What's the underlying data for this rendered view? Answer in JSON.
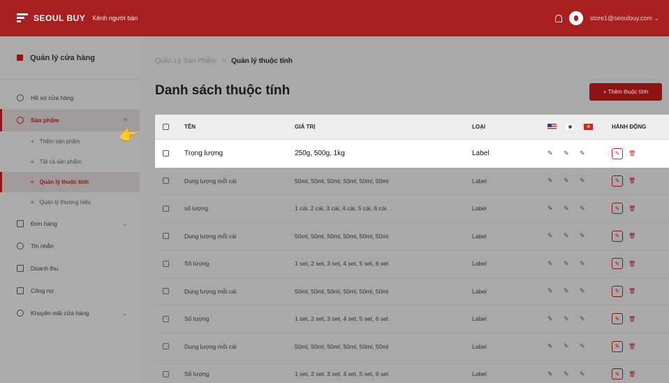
{
  "header": {
    "brand": "SEOUL BUY",
    "seller_channel": "Kênh người bán",
    "user_email": "store1@seoulbuy.com"
  },
  "sidebar": {
    "store_title": "Quản lý cửa hàng",
    "items": [
      {
        "label": "Hồ sơ cửa hàng"
      },
      {
        "label": "Sản phẩm"
      },
      {
        "label": "Đơn hàng"
      },
      {
        "label": "Tin nhắn"
      },
      {
        "label": "Doanh thu"
      },
      {
        "label": "Công nợ"
      },
      {
        "label": "Khuyến mãi cửa hàng"
      }
    ],
    "subitems": [
      {
        "label": "Thêm sản phẩm",
        "prefix": "+"
      },
      {
        "label": "Tất cả sản phẩm",
        "prefix": "≡"
      },
      {
        "label": "Quản lý thuộc tính",
        "prefix": "≡"
      },
      {
        "label": "Quản lý thương hiệu",
        "prefix": "≡"
      }
    ]
  },
  "breadcrumb": {
    "parent": "Quản Lý Sản Phẩm",
    "separator": ">",
    "current": "Quản lý thuộc tính"
  },
  "page": {
    "title": "Danh sách thuộc tính",
    "add_button": "+ Thêm thuộc tính"
  },
  "table": {
    "headers": {
      "name": "TÊN",
      "value": "GIÁ TRỊ",
      "type": "LOẠI",
      "actions": "HÀNH ĐỘNG"
    },
    "rows": [
      {
        "name": "Trọng lượng",
        "value": "250g, 500g, 1kg",
        "type": "Label"
      },
      {
        "name": "Dung lượng mỗi cái",
        "value": "50ml, 50ml, 50ml, 50ml, 50ml, 50ml",
        "type": "Label"
      },
      {
        "name": "số lượng",
        "value": "1 cái, 2 cái, 3 cái, 4 cái, 5 cái, 6 cái",
        "type": "Label"
      },
      {
        "name": "Dung lượng mỗi cái",
        "value": "50ml, 50ml, 50ml, 50ml, 50ml, 50ml",
        "type": "Label"
      },
      {
        "name": "Số lượng",
        "value": "1 set, 2 set, 3 set, 4 set, 5 set, 6 set",
        "type": "Label"
      },
      {
        "name": "Dung lượng mỗi cái",
        "value": "50ml, 50ml, 50ml, 50ml, 50ml, 50ml",
        "type": "Label"
      },
      {
        "name": "Số lượng",
        "value": "1 set, 2 set, 3 set, 4 set, 5 set, 6 set",
        "type": "Label"
      },
      {
        "name": "Dung lượng mỗi cái",
        "value": "50ml, 50ml, 50ml, 50ml, 50ml, 50ml",
        "type": "Label"
      },
      {
        "name": "Số lượng",
        "value": "1 set, 2 set, 3 set, 4 set, 5 set, 6 set",
        "type": "Label"
      }
    ]
  },
  "colors": {
    "brand": "#a91f1f",
    "accent": "#8e1414"
  },
  "icons": [
    "bell-icon",
    "user-avatar-icon",
    "store-icon",
    "pointing-hand-icon",
    "edit-icon",
    "trash-icon",
    "flag-us-icon",
    "flag-kr-icon",
    "flag-vn-icon"
  ]
}
